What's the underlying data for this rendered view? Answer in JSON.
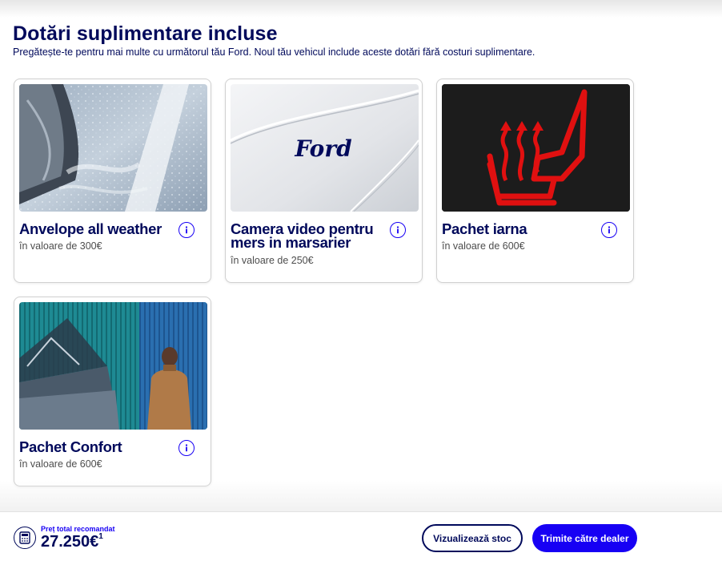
{
  "header": {
    "title": "Dotări suplimentare incluse",
    "subtitle": "Pregătește-te pentru mai multe cu următorul tău Ford. Noul tău vehicul include aceste dotări fără costuri suplimentare."
  },
  "cards": [
    {
      "title": "Anvelope all weather",
      "price": "în valoare de 300€",
      "image": "tire-on-wet-road-image"
    },
    {
      "title": "Camera video pentru mers in marsarier",
      "price": "în valoare de 250€",
      "image": "ford-logo-image",
      "logo_text": "Ford"
    },
    {
      "title": "Pachet iarna",
      "price": "în valoare de 600€",
      "image": "heated-seat-icon-image"
    },
    {
      "title": "Pachet Confort",
      "price": "în valoare de 600€",
      "image": "open-trunk-man-image"
    }
  ],
  "footer": {
    "price_label": "Preț total recomandat",
    "price_value": "27.250€",
    "price_sup": "1",
    "view_stock_label": "Vizualizează stoc",
    "send_dealer_label": "Trimite către dealer"
  },
  "colors": {
    "brand_navy": "#00095b",
    "accent_blue": "#1700f4",
    "heated_seat_red": "#e01010"
  }
}
